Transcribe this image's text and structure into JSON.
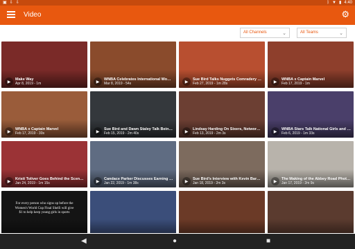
{
  "statusbar": {
    "left_icons": [
      "notification-icon",
      "download-icon",
      "download-icon"
    ],
    "time": "4:40"
  },
  "appbar": {
    "title": "Video"
  },
  "filters": {
    "channels": "All Channels",
    "teams": "All Teams"
  },
  "videos": [
    {
      "title": "Make Way",
      "meta": "Apr 8, 2019 - 1m",
      "bg": "#7a2a28"
    },
    {
      "title": "WNBA Celebrates International Wome...",
      "meta": "Mar 8, 2019 - 54s",
      "bg": "#8a4b2c"
    },
    {
      "title": "Sue Bird Talks Nuggets Comradery an...",
      "meta": "Feb 27, 2019 - 1m 28s",
      "bg": "#b84f30"
    },
    {
      "title": "WNBA x Captain Marvel",
      "meta": "Feb 17, 2019 - 1m",
      "bg": "#8e3f2c"
    },
    {
      "title": "WNBA x Captain Marvel",
      "meta": "Feb 17, 2019 - 30s",
      "bg": "#9a5c3a"
    },
    {
      "title": "Sue Bird and Dawn Staley Talk Being...",
      "meta": "Feb 15, 2019 - 2m 40s",
      "bg": "#34383c"
    },
    {
      "title": "Lindsay Harding On Sixers, Networkin...",
      "meta": "Feb 13, 2019 - 2m 3s",
      "bg": "#6c3f33"
    },
    {
      "title": "WNBA Stars Talk National Girls and Wo...",
      "meta": "Feb 6, 2019 - 1m 33s",
      "bg": "#4a3f6a"
    },
    {
      "title": "Kristi Toliver Goes Behind the Scenes...",
      "meta": "Jan 24, 2019 - 1m 15s",
      "bg": "#9b3336"
    },
    {
      "title": "Candace Parker Discusses Earning th...",
      "meta": "Jan 22, 2019 - 1m 38s",
      "bg": "#5f6c82"
    },
    {
      "title": "Sue Bird's Interview with Kevin Barnet...",
      "meta": "Jan 18, 2019 - 2m 3s",
      "bg": "#7d6b5e"
    },
    {
      "title": "The Making of the Abbey Road Photo fe...",
      "meta": "Jan 17, 2019 - 2m 9s",
      "bg": "#b8b3ab"
    },
    {
      "title": "",
      "meta": "",
      "bg": "#141414",
      "caption": "For every person who signs up before the Women's World Cup Final ShelS will give $1 to help keep young girls in sports"
    },
    {
      "title": "",
      "meta": "",
      "bg": "#3b4e7a"
    },
    {
      "title": "",
      "meta": "",
      "bg": "#6b3a27"
    },
    {
      "title": "",
      "meta": "",
      "bg": "#5b3b2f"
    }
  ],
  "navbar": {
    "back": "◀",
    "home": "●",
    "recents": "■"
  }
}
